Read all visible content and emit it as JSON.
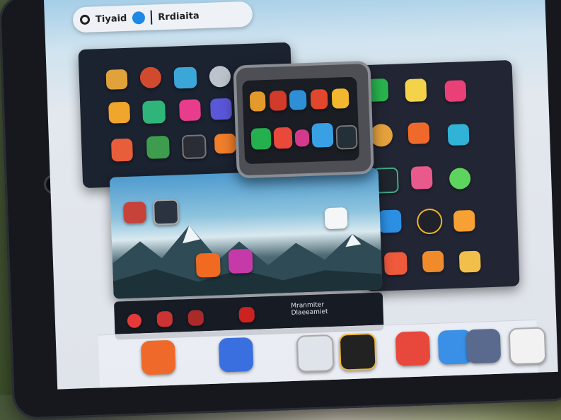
{
  "search": {
    "text_left": "Tiyaid",
    "text_right": "Rrdiaita"
  },
  "bottom_strip": {
    "title": "Mranmiter",
    "sub": "Dlaeeamiet"
  },
  "colors": {
    "accent": "#1e88e5",
    "bezel": "#16181d"
  }
}
